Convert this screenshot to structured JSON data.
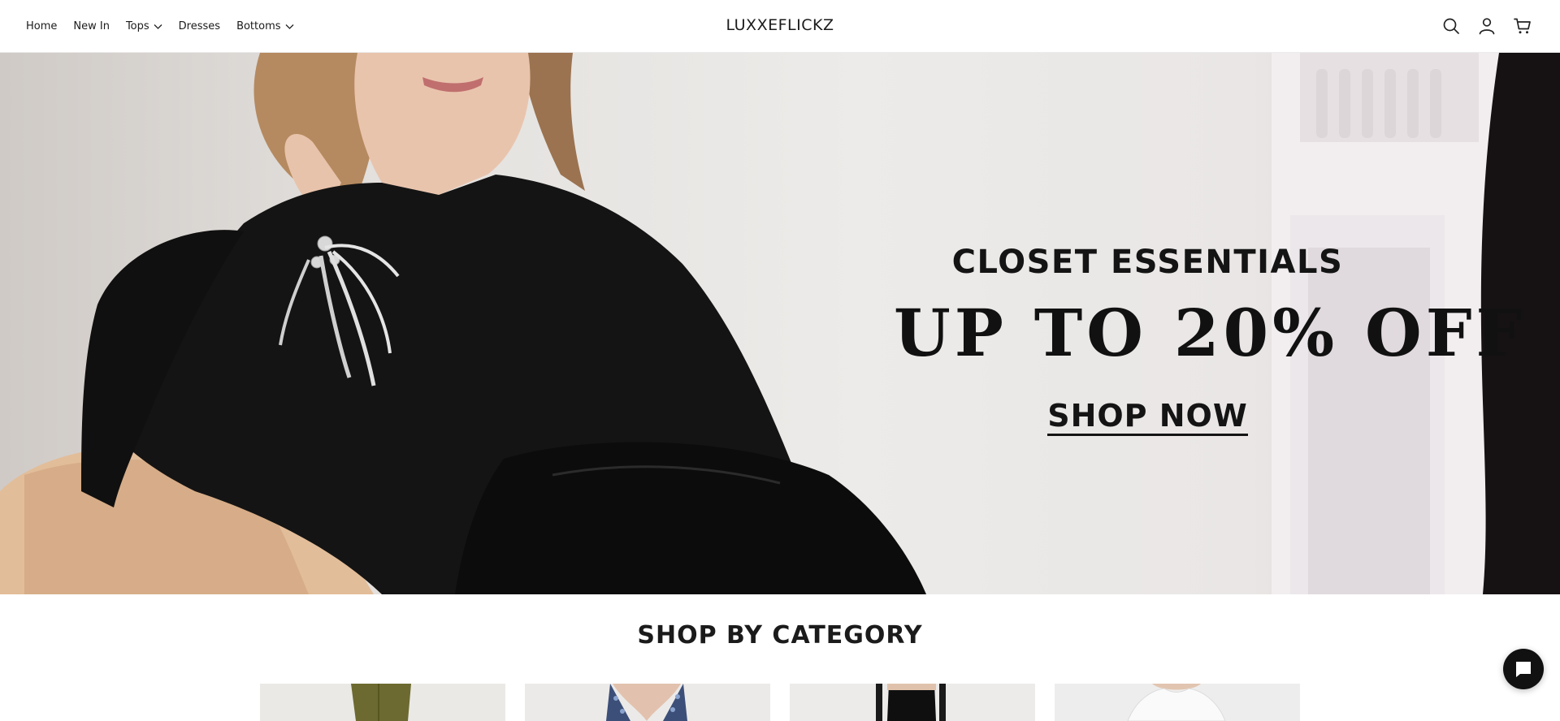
{
  "header": {
    "logo": "LUXXEFLICKZ",
    "nav": [
      {
        "label": "Home",
        "has_dropdown": false
      },
      {
        "label": "New In",
        "has_dropdown": false
      },
      {
        "label": "Tops",
        "has_dropdown": true
      },
      {
        "label": "Dresses",
        "has_dropdown": false
      },
      {
        "label": "Bottoms",
        "has_dropdown": true
      }
    ],
    "icons": [
      "search-icon",
      "account-icon",
      "cart-icon"
    ]
  },
  "hero": {
    "subtitle": "CLOSET ESSENTIALS",
    "title": "UP TO 20% OFF",
    "cta": "SHOP NOW"
  },
  "categories": {
    "heading": "SHOP BY CATEGORY",
    "cards": [
      {
        "image": "olive-trousers"
      },
      {
        "image": "floral-top"
      },
      {
        "image": "black-trousers"
      },
      {
        "image": "white-top"
      }
    ]
  },
  "chat": {
    "icon": "chat-icon"
  },
  "colors": {
    "text": "#111111",
    "background": "#ffffff",
    "accent": "#111111"
  }
}
